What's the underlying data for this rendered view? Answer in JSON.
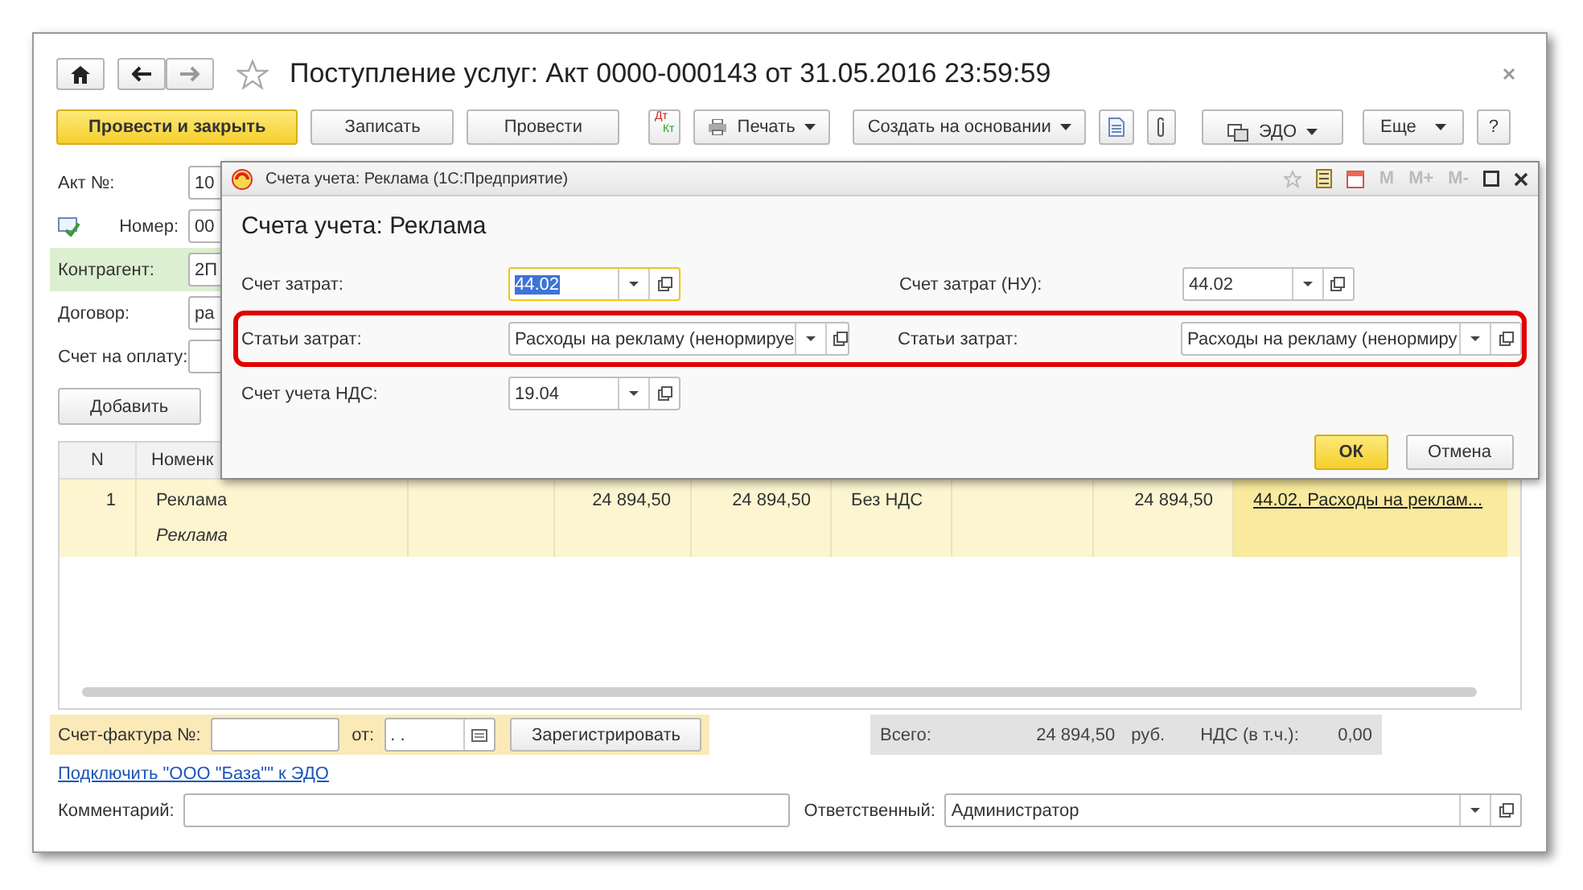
{
  "window": {
    "title": "Поступление услуг: Акт 0000-000143 от 31.05.2016 23:59:59"
  },
  "toolbar": [
    {
      "kind": "primary",
      "label": "Провести и закрыть"
    },
    {
      "kind": "plain",
      "label": "Записать"
    },
    {
      "kind": "plain",
      "label": "Провести"
    },
    {
      "kind": "dtkt",
      "label": "Дт",
      "sublabel": "Кт"
    },
    {
      "kind": "print",
      "label": "Печать"
    },
    {
      "kind": "menu",
      "label": "Создать на основании"
    },
    {
      "kind": "doc"
    },
    {
      "kind": "clip"
    },
    {
      "kind": "edo",
      "label": "ЭДО"
    },
    {
      "kind": "menu",
      "label": "Еще"
    },
    {
      "kind": "plain",
      "label": "?"
    }
  ],
  "form": {
    "rows": [
      {
        "kind": "plain",
        "label": "Акт №:",
        "value": "10",
        "highlighted": false
      },
      {
        "kind": "with-icon",
        "label": "Номер:",
        "value": "00",
        "highlighted": false
      },
      {
        "kind": "plain",
        "label": "Контрагент:",
        "value": "2П",
        "highlighted": true
      },
      {
        "kind": "plain",
        "label": "Договор:",
        "value": "ра",
        "highlighted": false
      },
      {
        "kind": "plain",
        "label": "Счет на оплату:",
        "value": "",
        "highlighted": false
      }
    ],
    "add_button": "Добавить"
  },
  "table": {
    "columns": [
      "N",
      "Номенк"
    ],
    "rows": [
      {
        "selected": true,
        "n": "1",
        "name": "Реклама",
        "content": "Реклама",
        "quantity": "24 894,50",
        "sum": "24 894,50",
        "vat_rate": "Без НДС",
        "total": "24 894,50",
        "account": "44.02, Расходы на реклам..."
      }
    ]
  },
  "invoice": {
    "label": "Счет-фактура №:",
    "date_label": "от:",
    "date_value": ".  .",
    "register_button": "Зарегистрировать"
  },
  "totals": {
    "label": "Всего:",
    "amount": "24 894,50",
    "currency": "руб.",
    "vat_label": "НДС (в т.ч.):",
    "vat": "0,00"
  },
  "edo_link": "Подключить \"ООО \"База\"\" к ЭДО",
  "comment": {
    "label": "Комментарий:"
  },
  "responsible": {
    "label": "Ответственный:",
    "value": "Администратор"
  },
  "dialog": {
    "window_title": "Счета учета: Реклама  (1С:Предприятие)",
    "memory_buttons": [
      "M",
      "M+",
      "M-"
    ],
    "heading": "Счета учета: Реклама",
    "rows": [
      {
        "highlighted": false,
        "fields": [
          {
            "kind": "account",
            "label": "Счет затрат:",
            "value": "44.02",
            "focused": true
          },
          {
            "kind": "account",
            "label": "Счет затрат (НУ):",
            "value": "44.02",
            "focused": false
          }
        ]
      },
      {
        "highlighted": true,
        "fields": [
          {
            "kind": "item",
            "label": "Статьи затрат:",
            "value": "Расходы на рекламу (ненормируе",
            "focused": false
          },
          {
            "kind": "item",
            "label": "Статьи затрат:",
            "value": "Расходы на рекламу (ненормиру",
            "focused": false
          }
        ]
      },
      {
        "highlighted": false,
        "fields": [
          {
            "kind": "account",
            "label": "Счет учета НДС:",
            "value": "19.04",
            "focused": false
          }
        ]
      }
    ],
    "ok_button": "ОК",
    "cancel_button": "Отмена"
  }
}
